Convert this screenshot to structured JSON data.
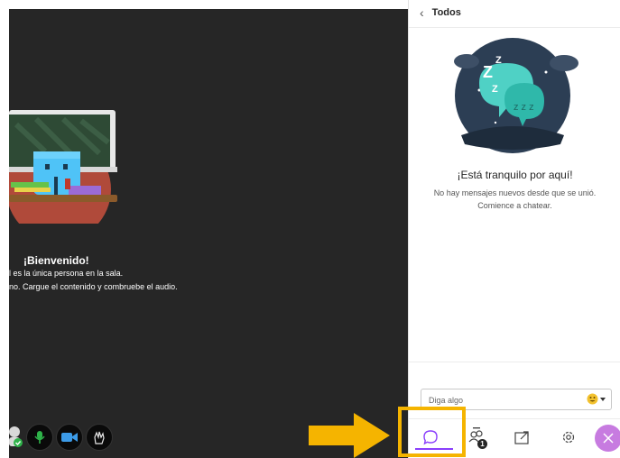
{
  "stage": {
    "welcome_title": "¡Bienvenido!",
    "welcome_line1": "l es la única persona en la sala.",
    "welcome_line2": "no. Cargue el contenido y combruebe el audio."
  },
  "panel": {
    "back_label": "Todos",
    "empty_title": "¡Está tranquilo por aquí!",
    "empty_line1": "No hay mensajes nuevos desde que se unió.",
    "empty_line2": "Comience a chatear.",
    "input_placeholder": "Diga algo",
    "attendee_count": "1"
  },
  "colors": {
    "stage_bg": "#262626",
    "accent_purple": "#8a3ffc",
    "close_button": "#c77be0",
    "highlight": "#f5b400"
  },
  "icons": [
    "chevron-left-icon",
    "mic-icon",
    "camera-icon",
    "hand-icon",
    "chat-icon",
    "attendees-icon",
    "share-icon",
    "settings-icon",
    "close-icon",
    "emoji-icon"
  ]
}
